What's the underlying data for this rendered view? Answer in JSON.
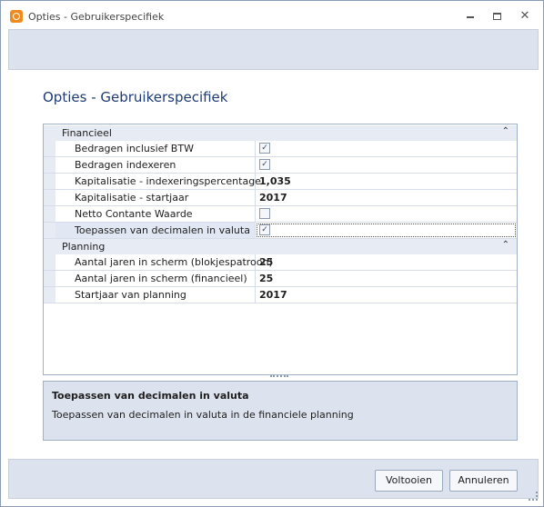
{
  "window": {
    "title": "Opties - Gebruikerspecifiek",
    "icon": "settings-app-icon"
  },
  "page": {
    "heading": "Opties - Gebruikerspecifiek"
  },
  "grid": {
    "categories": [
      {
        "label": "Financieel",
        "rows": [
          {
            "name": "Bedragen inclusief BTW",
            "type": "checkbox",
            "checked": true
          },
          {
            "name": "Bedragen indexeren",
            "type": "checkbox",
            "checked": true
          },
          {
            "name": "Kapitalisatie - indexeringspercentage",
            "type": "text",
            "value": "1,035"
          },
          {
            "name": "Kapitalisatie - startjaar",
            "type": "text",
            "value": "2017"
          },
          {
            "name": "Netto Contante Waarde",
            "type": "checkbox",
            "checked": false
          },
          {
            "name": "Toepassen van decimalen in valuta",
            "type": "checkbox",
            "checked": true,
            "selected": true
          }
        ]
      },
      {
        "label": "Planning",
        "rows": [
          {
            "name": "Aantal jaren in scherm (blokjespatroon)",
            "type": "text",
            "value": "25"
          },
          {
            "name": "Aantal jaren in scherm (financieel)",
            "type": "text",
            "value": "25"
          },
          {
            "name": "Startjaar van planning",
            "type": "text",
            "value": "2017"
          }
        ]
      }
    ]
  },
  "description": {
    "title": "Toepassen van decimalen in valuta",
    "text": "Toepassen van decimalen in valuta in de financiele planning"
  },
  "buttons": {
    "ok": "Voltooien",
    "cancel": "Annuleren"
  },
  "colors": {
    "accent": "#1f3c76",
    "panel": "#dde3ee",
    "border": "#9fb0c8",
    "app_icon": "#f08a1c"
  }
}
